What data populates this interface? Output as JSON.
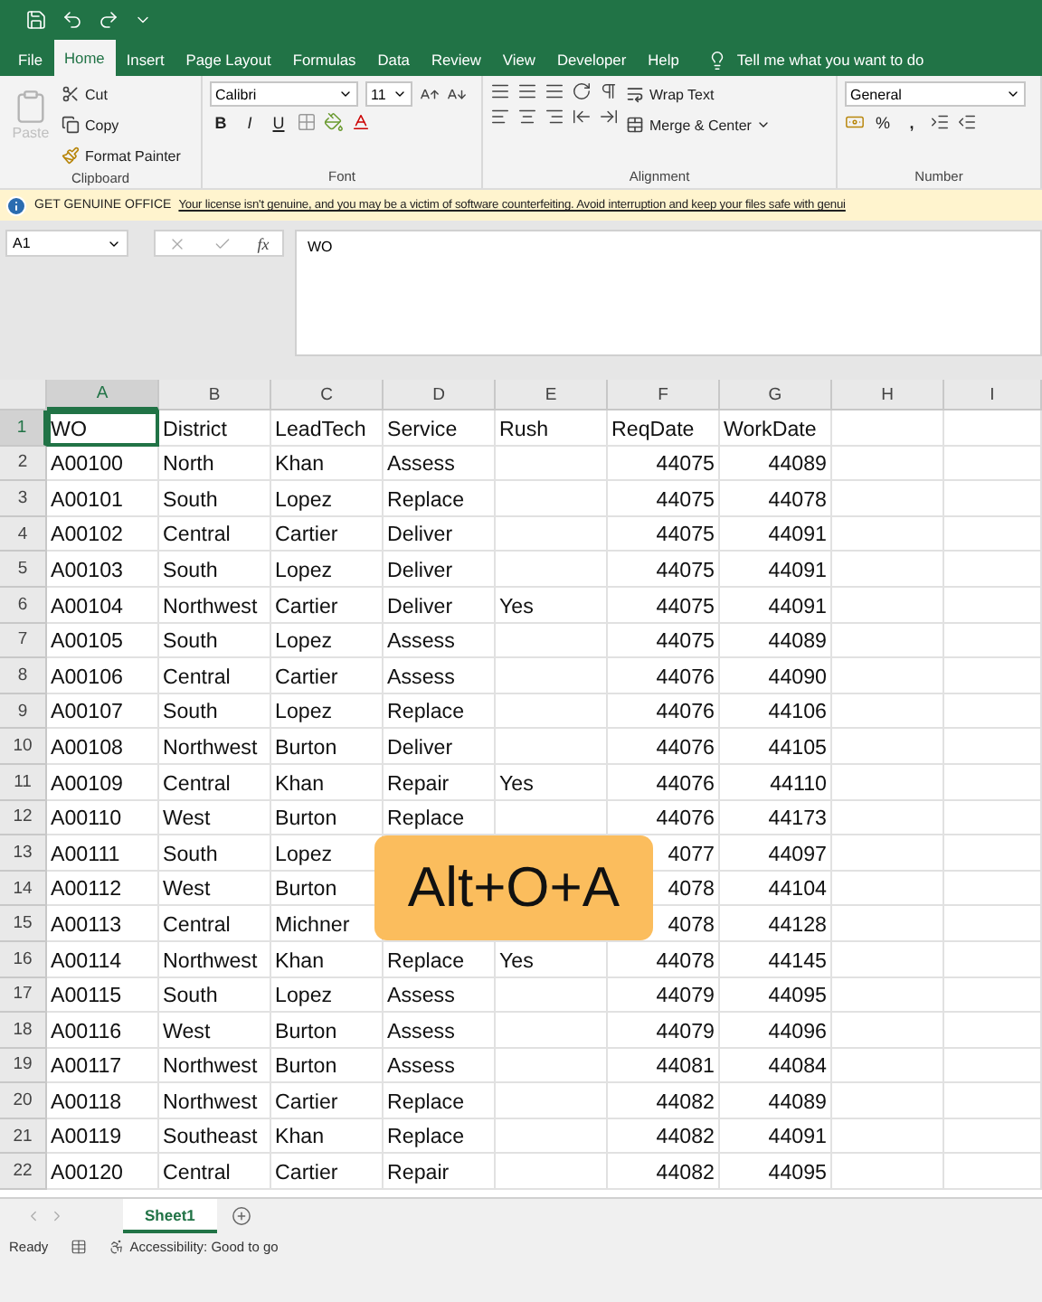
{
  "ribbon_tabs": [
    {
      "label": "File",
      "selected": false
    },
    {
      "label": "Home",
      "selected": true
    },
    {
      "label": "Insert",
      "selected": false
    },
    {
      "label": "Page Layout",
      "selected": false
    },
    {
      "label": "Formulas",
      "selected": false
    },
    {
      "label": "Data",
      "selected": false
    },
    {
      "label": "Review",
      "selected": false
    },
    {
      "label": "View",
      "selected": false
    },
    {
      "label": "Developer",
      "selected": false
    },
    {
      "label": "Help",
      "selected": false
    }
  ],
  "tell_me": {
    "placeholder": "Tell me what you want to do"
  },
  "clipboard": {
    "paste": "Paste",
    "paste_disabled": true,
    "cut": "Cut",
    "copy": "Copy",
    "format_painter": "Format Painter",
    "label": "Clipboard"
  },
  "font": {
    "name": "Calibri",
    "size": "11",
    "bold": "B",
    "italic": "I",
    "underline": "U",
    "label": "Font"
  },
  "alignment": {
    "wrap_text": "Wrap Text",
    "merge": "Merge & Center",
    "label": "Alignment"
  },
  "number": {
    "format": "General",
    "percent": "%",
    "comma": ",",
    "label": "Number"
  },
  "license_bar": {
    "title": "GET GENUINE OFFICE",
    "message": "Your license isn't genuine, and you may be a victim of software counterfeiting. Avoid interruption and keep your files safe with genui"
  },
  "formula_bar": {
    "name_box": "A1",
    "fx": "fx",
    "content": "WO"
  },
  "columns": [
    {
      "label": "A",
      "selected": true
    },
    {
      "label": "B",
      "selected": false
    },
    {
      "label": "C",
      "selected": false
    },
    {
      "label": "D",
      "selected": false
    },
    {
      "label": "E",
      "selected": false
    },
    {
      "label": "F",
      "selected": false
    },
    {
      "label": "G",
      "selected": false
    },
    {
      "label": "H",
      "selected": false
    },
    {
      "label": "I",
      "selected": false
    }
  ],
  "rows": [
    {
      "number": "1",
      "selected": true,
      "kind": "header",
      "cells": [
        "WO",
        "District",
        "LeadTech",
        "Service",
        "Rush",
        "ReqDate",
        "WorkDate"
      ]
    },
    {
      "number": "2",
      "selected": false,
      "kind": "data",
      "cells": [
        "A00100",
        "North",
        "Khan",
        "Assess",
        null,
        "44075",
        "44089"
      ]
    },
    {
      "number": "3",
      "selected": false,
      "kind": "data",
      "cells": [
        "A00101",
        "South",
        "Lopez",
        "Replace",
        null,
        "44075",
        "44078"
      ]
    },
    {
      "number": "4",
      "selected": false,
      "kind": "data",
      "cells": [
        "A00102",
        "Central",
        "Cartier",
        "Deliver",
        null,
        "44075",
        "44091"
      ]
    },
    {
      "number": "5",
      "selected": false,
      "kind": "data",
      "cells": [
        "A00103",
        "South",
        "Lopez",
        "Deliver",
        null,
        "44075",
        "44091"
      ]
    },
    {
      "number": "6",
      "selected": false,
      "kind": "data",
      "cells": [
        "A00104",
        "Northwest",
        "Cartier",
        "Deliver",
        "Yes",
        "44075",
        "44091"
      ]
    },
    {
      "number": "7",
      "selected": false,
      "kind": "data",
      "cells": [
        "A00105",
        "South",
        "Lopez",
        "Assess",
        null,
        "44075",
        "44089"
      ]
    },
    {
      "number": "8",
      "selected": false,
      "kind": "data",
      "cells": [
        "A00106",
        "Central",
        "Cartier",
        "Assess",
        null,
        "44076",
        "44090"
      ]
    },
    {
      "number": "9",
      "selected": false,
      "kind": "data",
      "cells": [
        "A00107",
        "South",
        "Lopez",
        "Replace",
        null,
        "44076",
        "44106"
      ]
    },
    {
      "number": "10",
      "selected": false,
      "kind": "data",
      "cells": [
        "A00108",
        "Northwest",
        "Burton",
        "Deliver",
        null,
        "44076",
        "44105"
      ]
    },
    {
      "number": "11",
      "selected": false,
      "kind": "data",
      "cells": [
        "A00109",
        "Central",
        "Khan",
        "Repair",
        "Yes",
        "44076",
        "44110"
      ]
    },
    {
      "number": "12",
      "selected": false,
      "kind": "data",
      "cells": [
        "A00110",
        "West",
        "Burton",
        "Replace",
        null,
        "44076",
        "44173"
      ]
    },
    {
      "number": "13",
      "selected": false,
      "kind": "data",
      "cells": [
        "A00111",
        "South",
        "Lopez",
        null,
        null,
        "4077",
        "44097"
      ]
    },
    {
      "number": "14",
      "selected": false,
      "kind": "data",
      "cells": [
        "A00112",
        "West",
        "Burton",
        null,
        null,
        "4078",
        "44104"
      ]
    },
    {
      "number": "15",
      "selected": false,
      "kind": "data",
      "cells": [
        "A00113",
        "Central",
        "Michner",
        null,
        null,
        "4078",
        "44128"
      ]
    },
    {
      "number": "16",
      "selected": false,
      "kind": "data",
      "cells": [
        "A00114",
        "Northwest",
        "Khan",
        "Replace",
        "Yes",
        "44078",
        "44145"
      ]
    },
    {
      "number": "17",
      "selected": false,
      "kind": "data",
      "cells": [
        "A00115",
        "South",
        "Lopez",
        "Assess",
        null,
        "44079",
        "44095"
      ]
    },
    {
      "number": "18",
      "selected": false,
      "kind": "data",
      "cells": [
        "A00116",
        "West",
        "Burton",
        "Assess",
        null,
        "44079",
        "44096"
      ]
    },
    {
      "number": "19",
      "selected": false,
      "kind": "data",
      "cells": [
        "A00117",
        "Northwest",
        "Burton",
        "Assess",
        null,
        "44081",
        "44084"
      ]
    },
    {
      "number": "20",
      "selected": false,
      "kind": "data",
      "cells": [
        "A00118",
        "Northwest",
        "Cartier",
        "Replace",
        null,
        "44082",
        "44089"
      ]
    },
    {
      "number": "21",
      "selected": false,
      "kind": "data",
      "cells": [
        "A00119",
        "Southeast",
        "Khan",
        "Replace",
        null,
        "44082",
        "44091"
      ]
    },
    {
      "number": "22",
      "selected": false,
      "kind": "data",
      "cells": [
        "A00120",
        "Central",
        "Cartier",
        "Repair",
        null,
        "44082",
        "44095"
      ]
    }
  ],
  "shortcut_overlay": "Alt+O+A",
  "sheets": [
    {
      "label": "Sheet1",
      "selected": true
    }
  ],
  "status_bar": {
    "mode": "Ready",
    "accessibility": "Accessibility: Good to go"
  }
}
